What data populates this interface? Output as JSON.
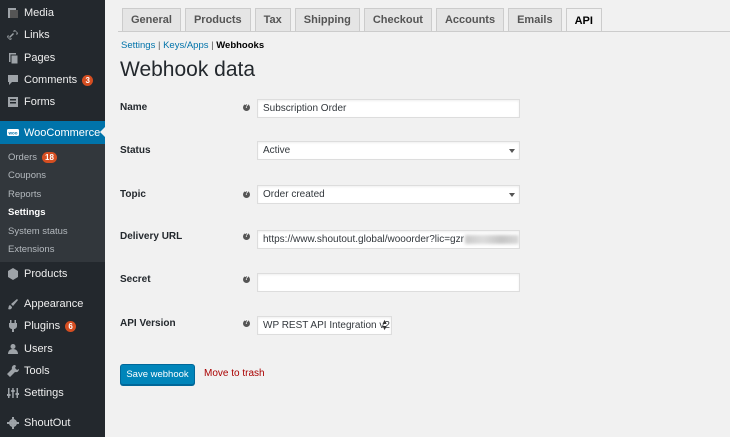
{
  "sidebar": {
    "items": [
      {
        "label": "Media",
        "icon": "media-icon"
      },
      {
        "label": "Links",
        "icon": "links-icon"
      },
      {
        "label": "Pages",
        "icon": "pages-icon"
      },
      {
        "label": "Comments",
        "icon": "comments-icon",
        "badge": "3"
      },
      {
        "label": "Forms",
        "icon": "forms-icon"
      },
      {
        "label": "WooCommerce",
        "icon": "woocommerce-icon"
      },
      {
        "label": "Products",
        "icon": "products-icon"
      },
      {
        "label": "Appearance",
        "icon": "appearance-icon"
      },
      {
        "label": "Plugins",
        "icon": "plugins-icon",
        "badge": "6"
      },
      {
        "label": "Users",
        "icon": "users-icon"
      },
      {
        "label": "Tools",
        "icon": "tools-icon"
      },
      {
        "label": "Settings",
        "icon": "settings-icon"
      },
      {
        "label": "ShoutOut",
        "icon": "gear-icon"
      }
    ],
    "submenu": [
      {
        "label": "Orders",
        "badge": "18"
      },
      {
        "label": "Coupons"
      },
      {
        "label": "Reports"
      },
      {
        "label": "Settings"
      },
      {
        "label": "System status"
      },
      {
        "label": "Extensions"
      }
    ]
  },
  "tabs": [
    "General",
    "Products",
    "Tax",
    "Shipping",
    "Checkout",
    "Accounts",
    "Emails",
    "API"
  ],
  "subnav": {
    "settings": "Settings",
    "sep1": "|",
    "keys": "Keys/Apps",
    "sep2": "|",
    "webhooks": "Webhooks"
  },
  "page_title": "Webhook data",
  "form": {
    "name_label": "Name",
    "name_value": "Subscription Order",
    "status_label": "Status",
    "status_value": "Active",
    "topic_label": "Topic",
    "topic_value": "Order created",
    "url_label": "Delivery URL",
    "url_value": "https://www.shoutout.global/wooorder?lic=gzr",
    "secret_label": "Secret",
    "secret_value": "",
    "api_label": "API Version",
    "api_value": "WP REST API Integration v2",
    "help_glyph": "?"
  },
  "actions": {
    "save": "Save webhook",
    "trash": "Move to trash"
  },
  "colors": {
    "sidebar_bg": "#23282d",
    "accent": "#0073aa",
    "badge": "#d54e21",
    "button": "#0085ba",
    "trash": "#aa0000"
  }
}
